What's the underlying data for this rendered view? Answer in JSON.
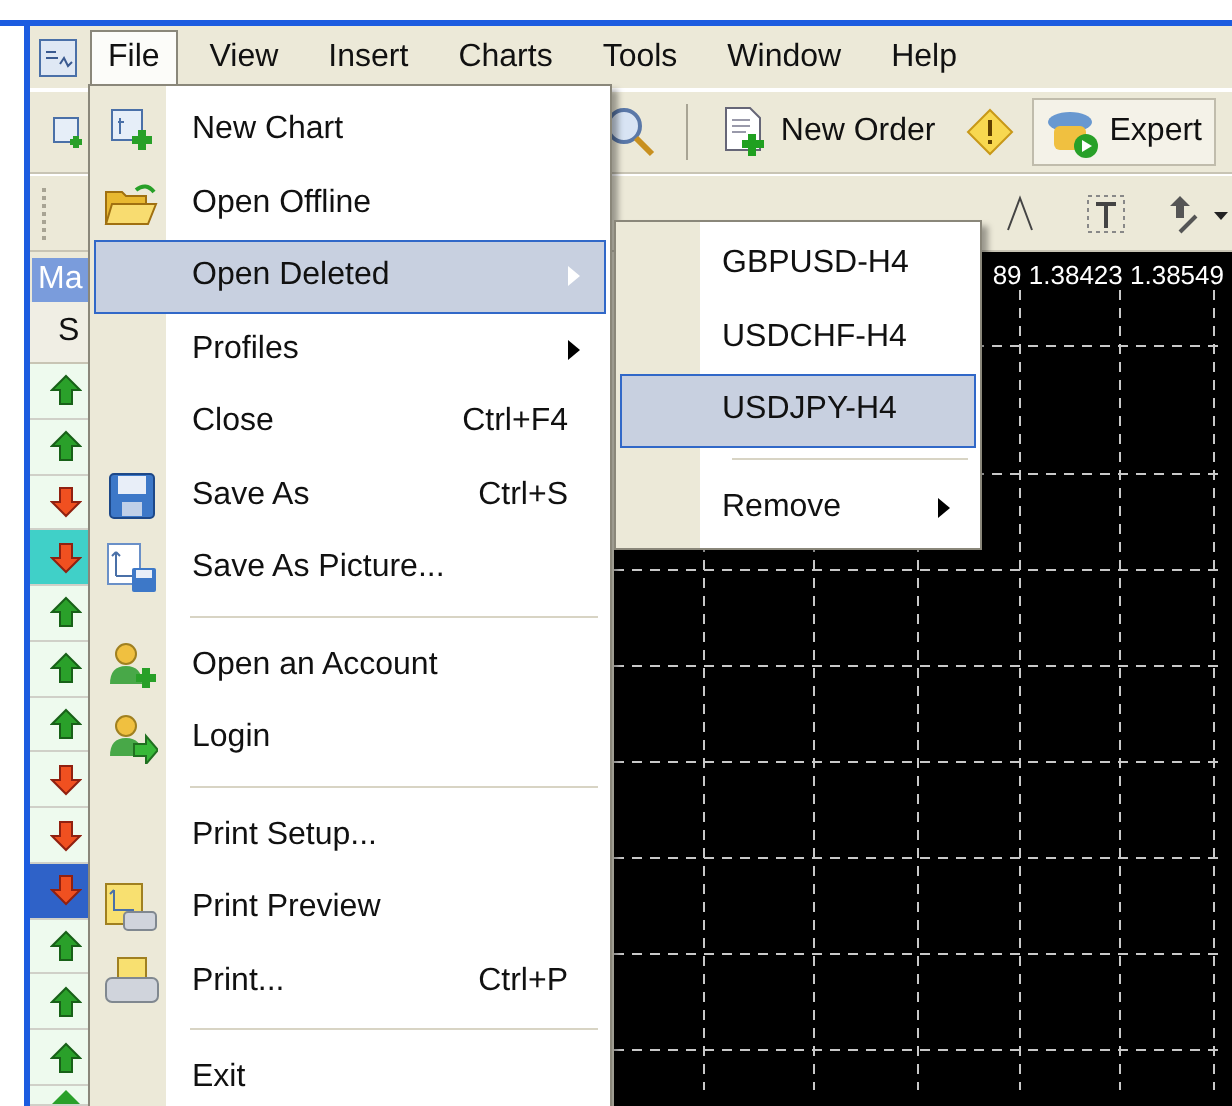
{
  "menu_bar": [
    {
      "label": "File",
      "selected": true
    },
    {
      "label": "View",
      "selected": false
    },
    {
      "label": "Insert",
      "selected": false
    },
    {
      "label": "Charts",
      "selected": false
    },
    {
      "label": "Tools",
      "selected": false
    },
    {
      "label": "Window",
      "selected": false
    },
    {
      "label": "Help",
      "selected": false
    }
  ],
  "toolbar": {
    "new_order": "New Order",
    "expert": "Expert"
  },
  "market_watch": {
    "tab": "Ma",
    "column_1": "S",
    "rows": [
      {
        "rising": true,
        "selected": false,
        "flash": false
      },
      {
        "rising": true,
        "selected": false,
        "flash": false
      },
      {
        "rising": false,
        "selected": false,
        "flash": false
      },
      {
        "rising": false,
        "selected": false,
        "flash": true
      },
      {
        "rising": true,
        "selected": false,
        "flash": false
      },
      {
        "rising": true,
        "selected": false,
        "flash": false
      },
      {
        "rising": true,
        "selected": false,
        "flash": false
      },
      {
        "rising": false,
        "selected": false,
        "flash": false
      },
      {
        "rising": false,
        "selected": false,
        "flash": false
      },
      {
        "rising": false,
        "selected": true,
        "flash": false
      },
      {
        "rising": true,
        "selected": false,
        "flash": false
      },
      {
        "rising": true,
        "selected": false,
        "flash": false
      },
      {
        "rising": true,
        "selected": false,
        "flash": false
      }
    ]
  },
  "chart": {
    "prices": "89 1.38423 1.38549"
  },
  "file_menu": [
    {
      "kind": "item",
      "label": "New Chart",
      "selected": false
    },
    {
      "kind": "item",
      "label": "Open Offline",
      "selected": false
    },
    {
      "kind": "submenu",
      "label": "Open Deleted",
      "selected": true
    },
    {
      "kind": "submenu",
      "label": "Profiles",
      "selected": false
    },
    {
      "kind": "item",
      "label": "Close",
      "shortcut": "Ctrl+F4",
      "selected": false
    },
    {
      "kind": "item",
      "label": "Save As",
      "shortcut": "Ctrl+S",
      "selected": false
    },
    {
      "kind": "item",
      "label": "Save As Picture...",
      "selected": false
    },
    {
      "kind": "separator"
    },
    {
      "kind": "item",
      "label": "Open an Account",
      "selected": false
    },
    {
      "kind": "item",
      "label": "Login",
      "selected": false
    },
    {
      "kind": "separator"
    },
    {
      "kind": "item",
      "label": "Print Setup...",
      "selected": false
    },
    {
      "kind": "item",
      "label": "Print Preview",
      "selected": false
    },
    {
      "kind": "item",
      "label": "Print...",
      "shortcut": "Ctrl+P",
      "selected": false
    },
    {
      "kind": "separator"
    },
    {
      "kind": "item",
      "label": "Exit",
      "selected": false
    }
  ],
  "open_deleted_submenu": [
    {
      "kind": "item",
      "label": "GBPUSD-H4",
      "selected": false
    },
    {
      "kind": "item",
      "label": "USDCHF-H4",
      "selected": false
    },
    {
      "kind": "item",
      "label": "USDJPY-H4",
      "selected": true
    },
    {
      "kind": "separator"
    },
    {
      "kind": "submenu",
      "label": "Remove",
      "selected": false
    }
  ]
}
